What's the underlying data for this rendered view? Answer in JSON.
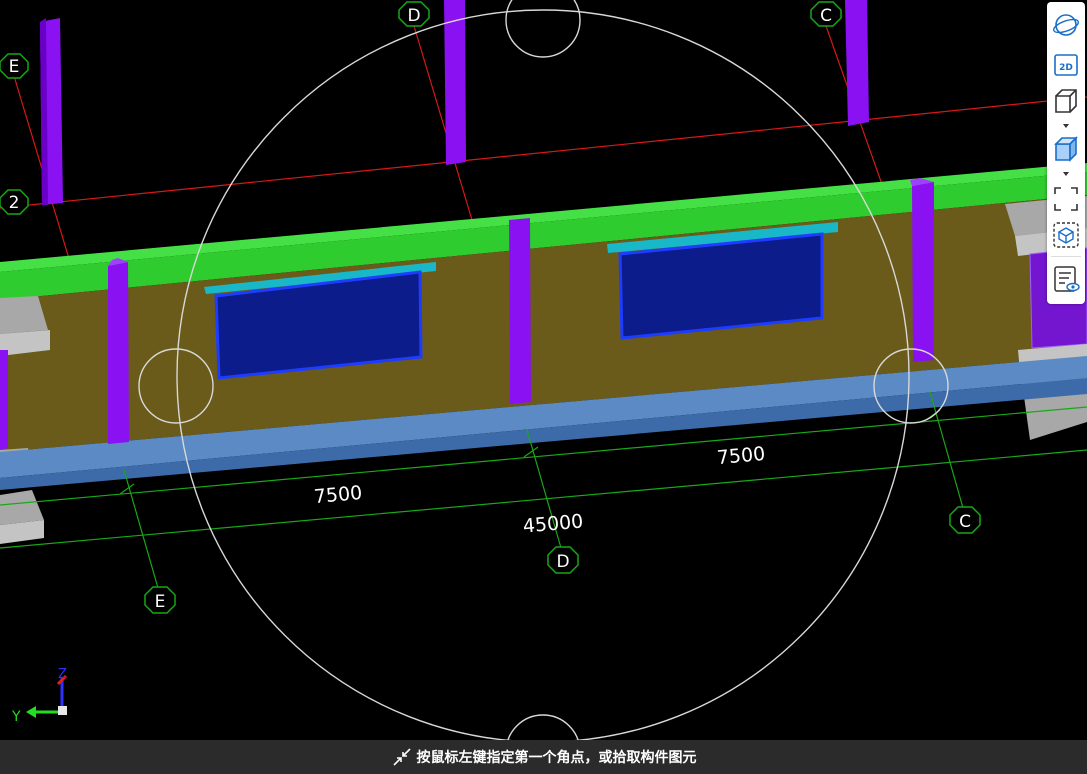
{
  "grid_labels": {
    "e_top": "E",
    "d_top": "D",
    "c_top": "C",
    "row_2": "2",
    "e_bottom": "E",
    "d_bottom": "D",
    "c_bottom": "C"
  },
  "dimensions": {
    "left_span": "7500",
    "right_span": "7500",
    "total": "45000"
  },
  "axis_indicator": {
    "z_label": "Z",
    "y_label": "Y"
  },
  "toolbar": {
    "buttons": [
      {
        "name": "orbit",
        "icon": "orbit-icon"
      },
      {
        "name": "2d-view",
        "icon": "2d-icon",
        "label": "2D"
      },
      {
        "name": "3d-view",
        "icon": "cube-outline-icon"
      },
      {
        "name": "render-mode",
        "icon": "cube-solid-icon"
      },
      {
        "name": "zoom-extents",
        "icon": "zoom-frame-icon"
      },
      {
        "name": "selection-view",
        "icon": "cube-dashed-icon"
      },
      {
        "name": "display-settings",
        "icon": "list-eye-icon"
      }
    ]
  },
  "status": {
    "message": "按鼠标左键指定第一个角点，或拾取构件图元"
  },
  "colors": {
    "background": "#000000",
    "beam_green": "#2ecc2e",
    "column_purple": "#8a12f2",
    "wall_olive": "#6a5b1a",
    "window_blue": "#0c1c8a",
    "slab_blue": "#5b8ac4",
    "grid_red": "#d61818",
    "dim_green": "#18a818",
    "status_bg": "#2b2b2b"
  }
}
